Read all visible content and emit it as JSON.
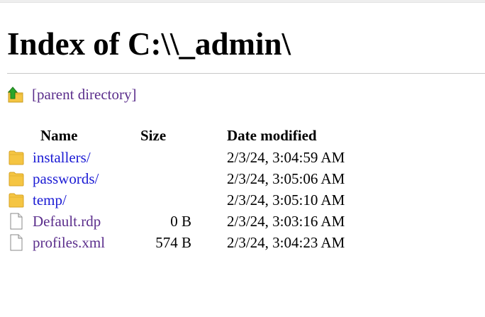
{
  "title": "Index of C:\\\\_admin\\",
  "parent_link": "[parent directory]",
  "columns": {
    "name": "Name",
    "size": "Size",
    "date": "Date modified"
  },
  "entries": [
    {
      "name": "installers/",
      "size": "",
      "date": "2/3/24, 3:04:59 AM",
      "icon": "folder-icon"
    },
    {
      "name": "passwords/",
      "size": "",
      "date": "2/3/24, 3:05:06 AM",
      "icon": "folder-icon"
    },
    {
      "name": "temp/",
      "size": "",
      "date": "2/3/24, 3:05:10 AM",
      "icon": "folder-icon"
    },
    {
      "name": "Default.rdp",
      "size": "0 B",
      "date": "2/3/24, 3:03:16 AM",
      "icon": "file-icon"
    },
    {
      "name": "profiles.xml",
      "size": "574 B",
      "date": "2/3/24, 3:04:23 AM",
      "icon": "file-icon"
    }
  ],
  "colors": {
    "link": "#1a1ad4",
    "visited_link": "#5b2e8c",
    "folder": "#f5c542"
  }
}
